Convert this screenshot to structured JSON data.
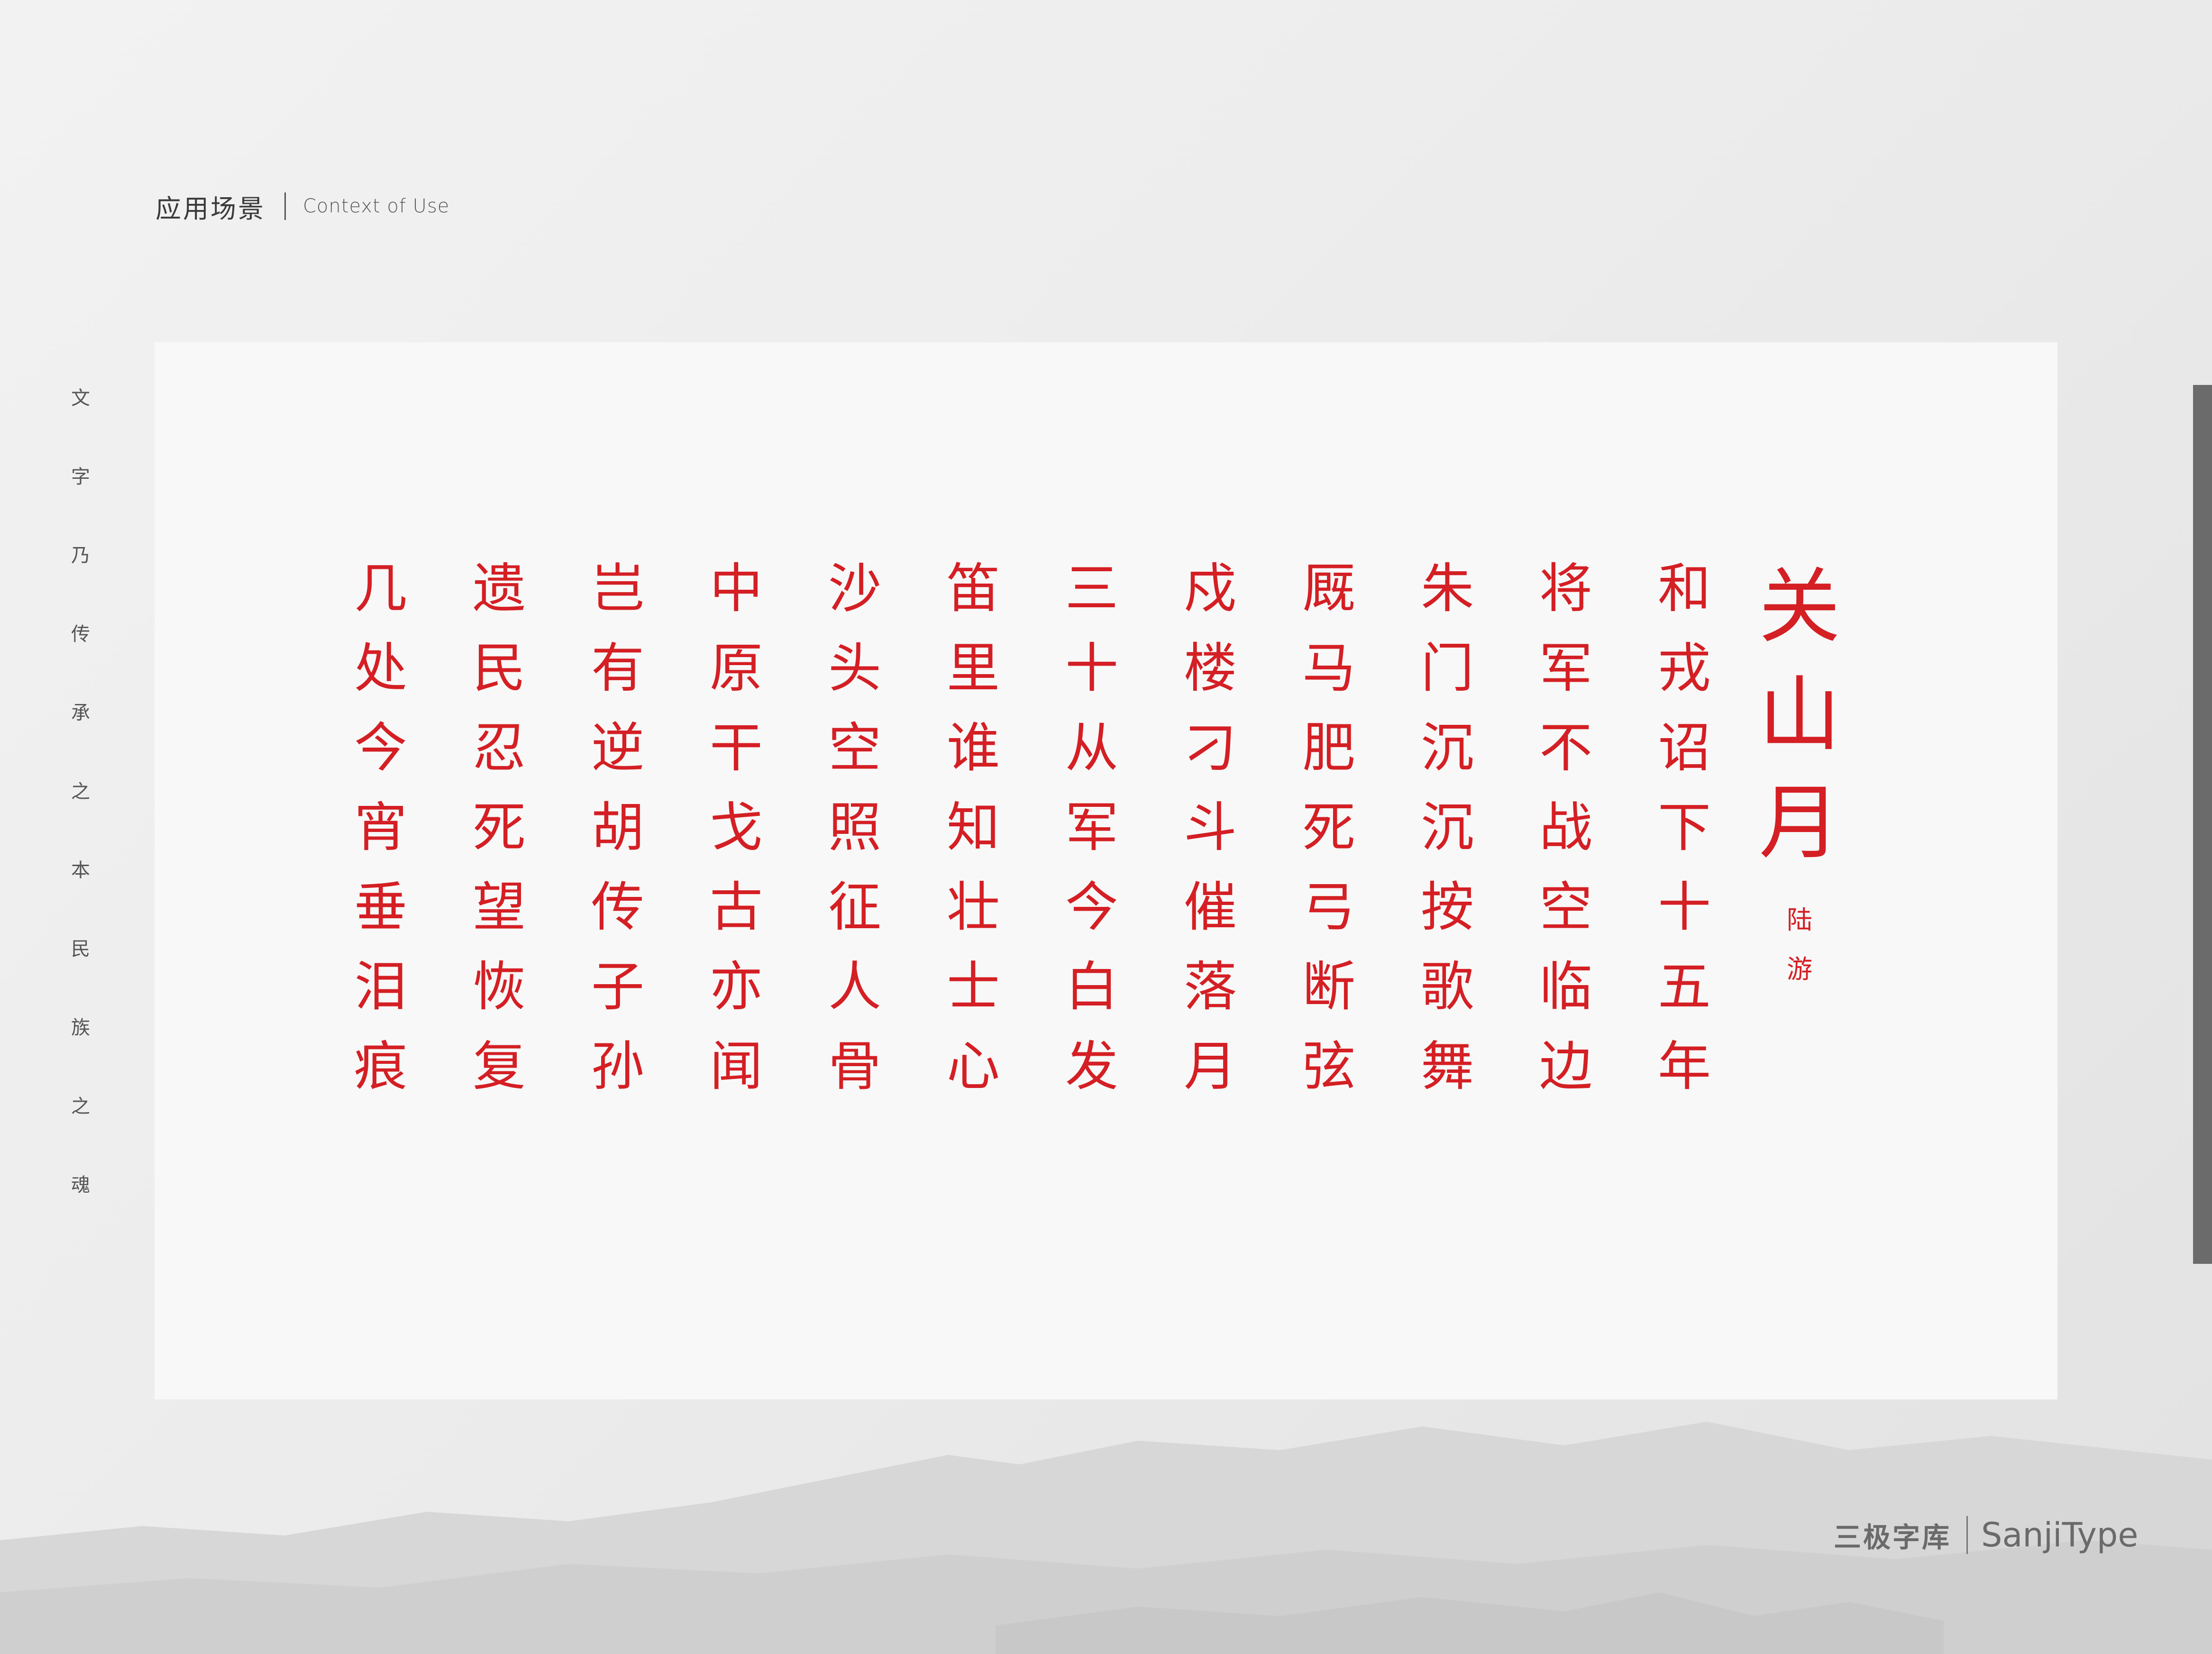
{
  "header": {
    "title_cn": "应用场景",
    "title_en": "Context of Use"
  },
  "side_text": [
    "文",
    "字",
    "乃",
    "传",
    "承",
    "之",
    "本",
    "民",
    "族",
    "之",
    "魂"
  ],
  "poem": {
    "title": [
      "关",
      "山",
      "月"
    ],
    "author": [
      "陆",
      "游"
    ],
    "columns": [
      [
        "和",
        "戎",
        "诏",
        "下",
        "十",
        "五",
        "年"
      ],
      [
        "将",
        "军",
        "不",
        "战",
        "空",
        "临",
        "边"
      ],
      [
        "朱",
        "门",
        "沉",
        "沉",
        "按",
        "歌",
        "舞"
      ],
      [
        "厩",
        "马",
        "肥",
        "死",
        "弓",
        "断",
        "弦"
      ],
      [
        "戍",
        "楼",
        "刁",
        "斗",
        "催",
        "落",
        "月"
      ],
      [
        "三",
        "十",
        "从",
        "军",
        "今",
        "白",
        "发"
      ],
      [
        "笛",
        "里",
        "谁",
        "知",
        "壮",
        "士",
        "心"
      ],
      [
        "沙",
        "头",
        "空",
        "照",
        "征",
        "人",
        "骨"
      ],
      [
        "中",
        "原",
        "干",
        "戈",
        "古",
        "亦",
        "闻"
      ],
      [
        "岂",
        "有",
        "逆",
        "胡",
        "传",
        "子",
        "孙"
      ],
      [
        "遗",
        "民",
        "忍",
        "死",
        "望",
        "恢",
        "复"
      ],
      [
        "几",
        "处",
        "今",
        "宵",
        "垂",
        "泪",
        "痕"
      ]
    ]
  },
  "footer": {
    "brand_cn": "三极字库",
    "brand_en": "SanjiType"
  },
  "colors": {
    "poem_red": "#d41f24",
    "panel": "#f8f8f8",
    "background": "#ececec",
    "scrollbar": "#6b6b6b"
  }
}
